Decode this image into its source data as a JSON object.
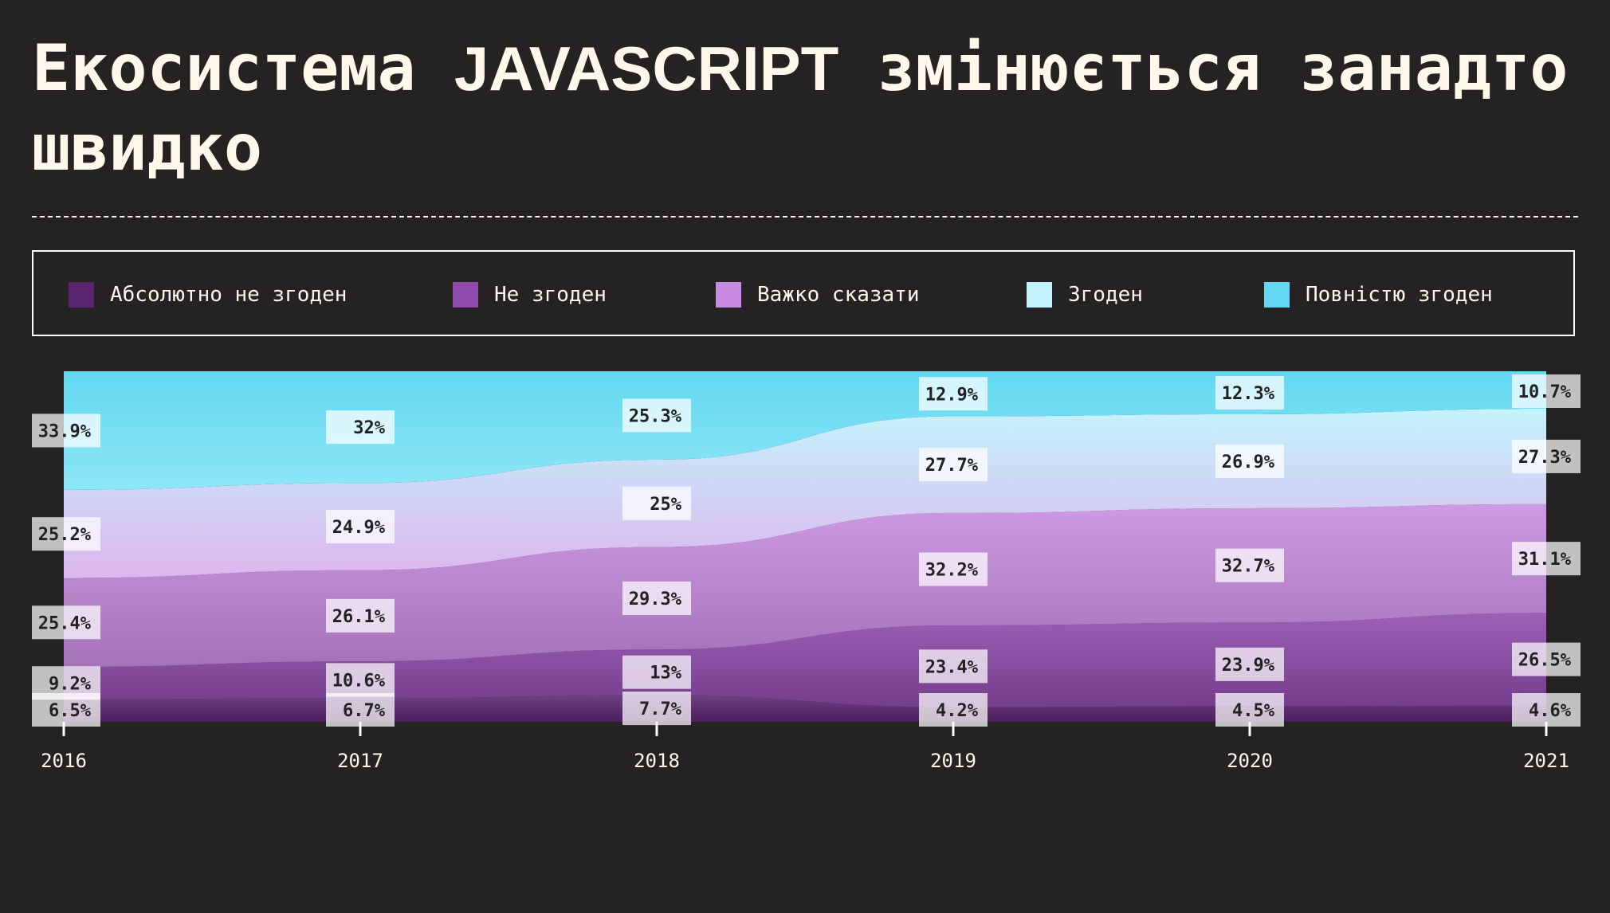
{
  "title": {
    "before": "Екосистема ",
    "highlight": "JAVASCRIPT",
    "after": " змінюється занадто швидко"
  },
  "colors": {
    "background": "#252223",
    "text": "#fff8ea"
  },
  "chart_data": {
    "type": "area",
    "stacked": true,
    "normalized": true,
    "x": [
      "2016",
      "2017",
      "2018",
      "2019",
      "2020",
      "2021"
    ],
    "ylim": [
      0,
      100
    ],
    "legend_position": "top",
    "series": [
      {
        "name": "Абсолютно не згоден",
        "color": "#5a2670",
        "values": [
          6.5,
          6.7,
          7.7,
          4.2,
          4.5,
          4.6
        ],
        "labels": [
          "6.5%",
          "6.7%",
          "7.7%",
          "4.2%",
          "4.5%",
          "4.6%"
        ]
      },
      {
        "name": "Не згоден",
        "color": "#8f4aac",
        "values": [
          9.2,
          10.6,
          13,
          23.4,
          23.9,
          26.5
        ],
        "labels": [
          "9.2%",
          "10.6%",
          "13%",
          "23.4%",
          "23.9%",
          "26.5%"
        ]
      },
      {
        "name": "Важко сказати",
        "color": "#c88be0",
        "values": [
          25.4,
          26.1,
          29.3,
          32.2,
          32.7,
          31.1
        ],
        "labels": [
          "25.4%",
          "26.1%",
          "29.3%",
          "32.2%",
          "32.7%",
          "31.1%"
        ]
      },
      {
        "name": "Згоден",
        "color": "#c4f3fc",
        "values": [
          25.2,
          24.9,
          25,
          27.7,
          26.9,
          27.3
        ],
        "labels": [
          "25.2%",
          "24.9%",
          "25%",
          "27.7%",
          "26.9%",
          "27.3%"
        ]
      },
      {
        "name": "Повністю згоден",
        "color": "#62d8f1",
        "values": [
          33.9,
          32,
          25.3,
          12.9,
          12.3,
          10.7
        ],
        "labels": [
          "33.9%",
          "32%",
          "25.3%",
          "12.9%",
          "12.3%",
          "10.7%"
        ]
      }
    ]
  }
}
